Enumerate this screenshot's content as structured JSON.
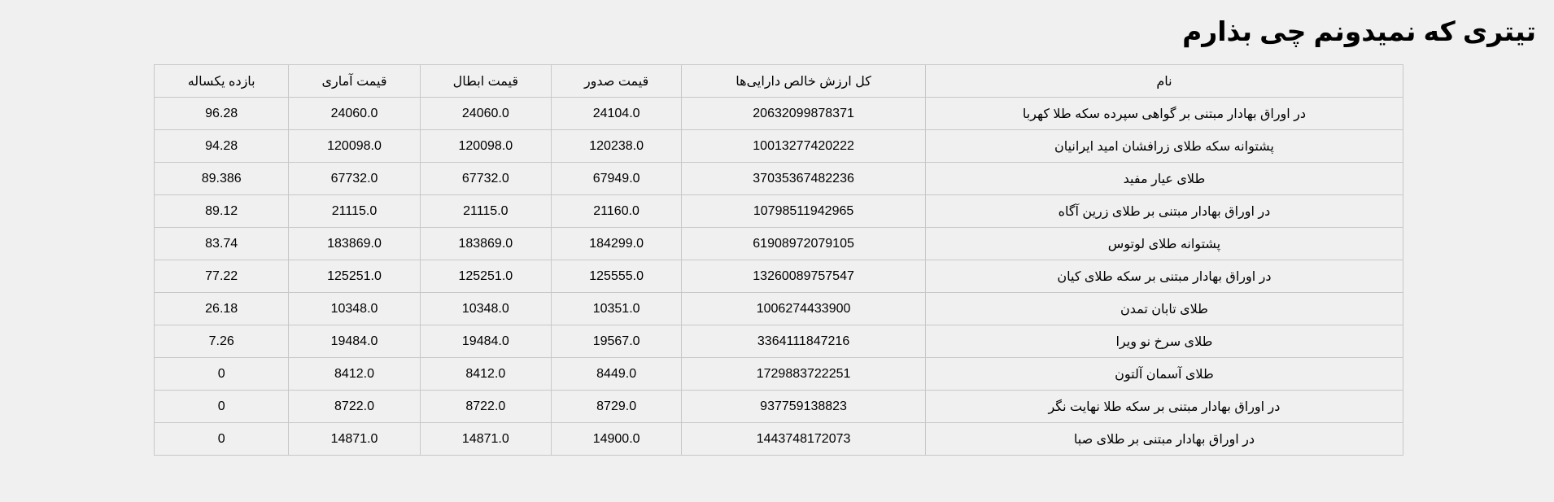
{
  "page": {
    "title": "تیتری که نمیدونم چی بذارم"
  },
  "table": {
    "headers": {
      "name": "نام",
      "nav": "کل ارزش خالص دارایی‌ها",
      "issue": "قیمت صدور",
      "cancel": "قیمت ابطال",
      "stat": "قیمت آماری",
      "return": "بازده یکساله"
    },
    "rows": [
      {
        "name": "در اوراق بهادار مبتنی بر گواهی سپرده سکه طلا کهربا",
        "nav": "20632099878371",
        "issue": "24104.0",
        "cancel": "24060.0",
        "stat": "24060.0",
        "return": "96.28"
      },
      {
        "name": "پشتوانه سکه طلای زرافشان امید ایرانیان",
        "nav": "10013277420222",
        "issue": "120238.0",
        "cancel": "120098.0",
        "stat": "120098.0",
        "return": "94.28"
      },
      {
        "name": "طلای عیار مفید",
        "nav": "37035367482236",
        "issue": "67949.0",
        "cancel": "67732.0",
        "stat": "67732.0",
        "return": "89.386"
      },
      {
        "name": "در اوراق بهادار مبتنی بر طلای زرین آگاه",
        "nav": "10798511942965",
        "issue": "21160.0",
        "cancel": "21115.0",
        "stat": "21115.0",
        "return": "89.12"
      },
      {
        "name": "پشتوانه طلای لوتوس",
        "nav": "61908972079105",
        "issue": "184299.0",
        "cancel": "183869.0",
        "stat": "183869.0",
        "return": "83.74"
      },
      {
        "name": "در اوراق بهادار مبتنی بر سکه طلای کیان",
        "nav": "13260089757547",
        "issue": "125555.0",
        "cancel": "125251.0",
        "stat": "125251.0",
        "return": "77.22"
      },
      {
        "name": "طلای تابان تمدن",
        "nav": "1006274433900",
        "issue": "10351.0",
        "cancel": "10348.0",
        "stat": "10348.0",
        "return": "26.18"
      },
      {
        "name": "طلای سرخ نو ویرا",
        "nav": "3364111847216",
        "issue": "19567.0",
        "cancel": "19484.0",
        "stat": "19484.0",
        "return": "7.26"
      },
      {
        "name": "طلای آسمان آلتون",
        "nav": "1729883722251",
        "issue": "8449.0",
        "cancel": "8412.0",
        "stat": "8412.0",
        "return": "0"
      },
      {
        "name": "در اوراق بهادار مبتنی بر سکه طلا نهایت نگر",
        "nav": "937759138823",
        "issue": "8729.0",
        "cancel": "8722.0",
        "stat": "8722.0",
        "return": "0"
      },
      {
        "name": "در اوراق بهادار مبتنی بر طلای صبا",
        "nav": "1443748172073",
        "issue": "14900.0",
        "cancel": "14871.0",
        "stat": "14871.0",
        "return": "0"
      }
    ]
  }
}
